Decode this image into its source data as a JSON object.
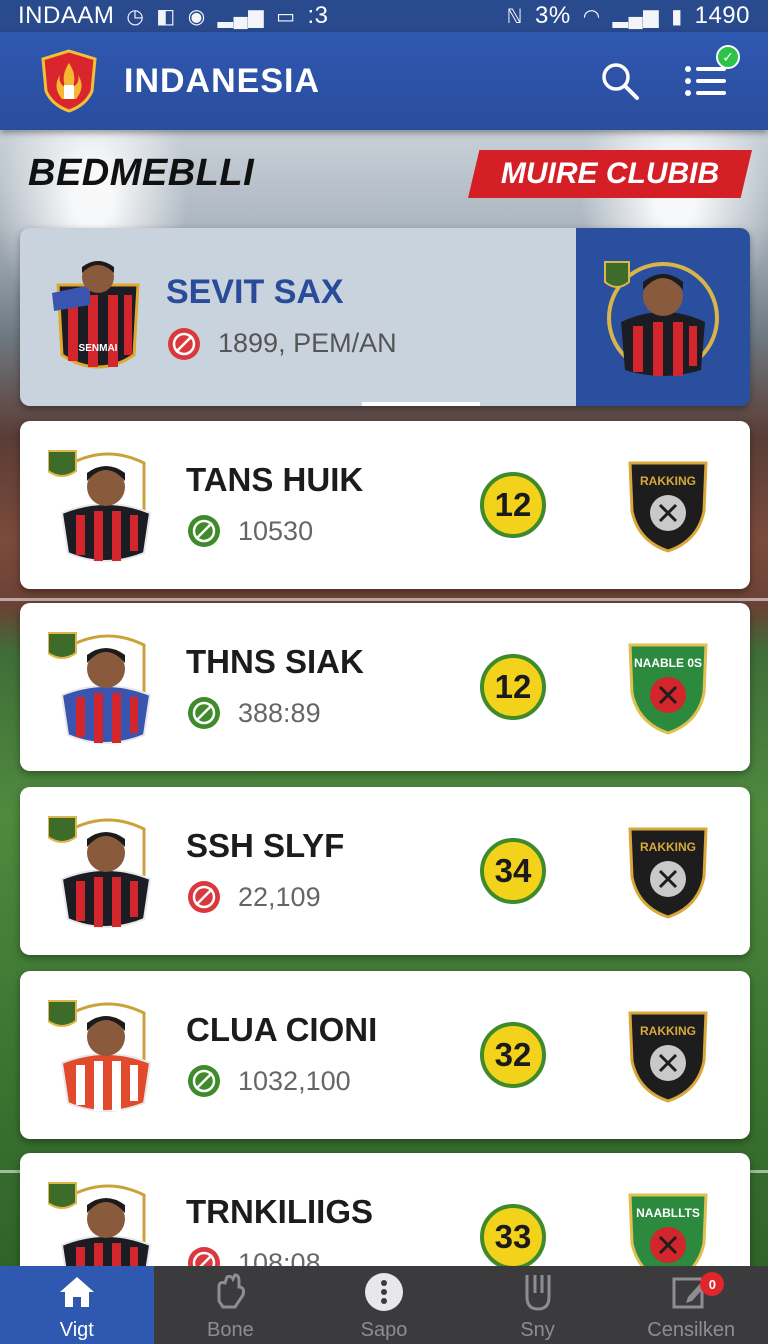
{
  "status_bar": {
    "carrier": "INDAAM",
    "left_extra": ":3",
    "battery": "3%",
    "time": "1490"
  },
  "header": {
    "title": "INDANESIA",
    "search_icon": "search-icon",
    "menu_icon": "list-menu-icon"
  },
  "section": {
    "title": "BEDMEBLLI",
    "more_button": "MUIRE CLUBIB"
  },
  "featured": {
    "name": "SEVIT SAX",
    "detail": "1899, PEM/AN",
    "jersey_text": "SENMAI"
  },
  "players": [
    {
      "name": "TANS HUIK",
      "stat": "10530",
      "rank": "12",
      "crest_text": "RAKKING"
    },
    {
      "name": "THNS SIAK",
      "stat": "388:89",
      "rank": "12",
      "crest_text": "NAABLE 0S"
    },
    {
      "name": "SSH SLYF",
      "stat": "22,109",
      "rank": "34",
      "crest_text": "RAKKING"
    },
    {
      "name": "CLUA CIONI",
      "stat": "1032,100",
      "rank": "32",
      "crest_text": "RAKKING"
    },
    {
      "name": "TRNKILIIGS",
      "stat": "108:08",
      "rank": "33",
      "crest_text": "NAABLLTS"
    }
  ],
  "bottom_nav": [
    {
      "label": "Vigt",
      "icon": "home-icon"
    },
    {
      "label": "Bone",
      "icon": "hand-icon"
    },
    {
      "label": "Sapo",
      "icon": "more-dots-icon"
    },
    {
      "label": "Sny",
      "icon": "hand-raise-icon"
    },
    {
      "label": "Censilken",
      "icon": "edit-icon",
      "badge": "0"
    }
  ],
  "colors": {
    "primary_blue": "#2f58b0",
    "accent_red": "#d51f26",
    "rank_yellow": "#f2d21b",
    "rank_green": "#3f8a2b"
  }
}
